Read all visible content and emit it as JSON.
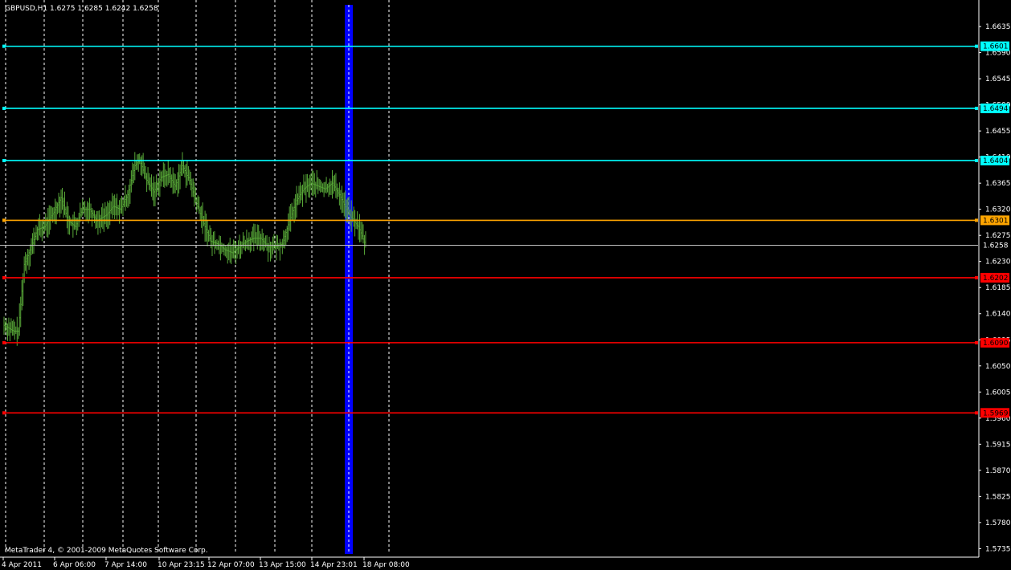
{
  "chart_data": {
    "type": "candlestick",
    "title": "GBPUSD,H1  1.6275 1.6285 1.6242 1.6258",
    "symbol": "GBPUSD",
    "timeframe": "H1",
    "ohlc_header": {
      "open": 1.6275,
      "high": 1.6285,
      "low": 1.6242,
      "close": 1.6258
    },
    "copyright": "MetaTrader 4, © 2001-2009 MetaQuotes Software Corp.",
    "ylim": [
      1.573,
      1.666
    ],
    "y_ticks": [
      1.6635,
      1.659,
      1.6545,
      1.65,
      1.6455,
      1.641,
      1.6365,
      1.632,
      1.6275,
      1.623,
      1.6185,
      1.614,
      1.6095,
      1.605,
      1.6005,
      1.596,
      1.5915,
      1.587,
      1.5825,
      1.578,
      1.5735
    ],
    "x_tick_labels": [
      "4 Apr 2011",
      "6 Apr 06:00",
      "7 Apr 14:00",
      "10 Apr 23:15",
      "12 Apr 07:00",
      "13 Apr 15:00",
      "14 Apr 23:01",
      "18 Apr 08:00"
    ],
    "current_price": 1.6258,
    "horizontal_levels": [
      {
        "value": 1.6601,
        "label": "1.6601",
        "color": "#00ffff"
      },
      {
        "value": 1.6494,
        "label": "1.6494",
        "color": "#00ffff"
      },
      {
        "value": 1.6404,
        "label": "1.6404",
        "color": "#00ffff"
      },
      {
        "value": 1.6301,
        "label": "1.6301",
        "color": "#ffa500"
      },
      {
        "value": 1.6202,
        "label": "1.6202",
        "color": "#ff0000"
      },
      {
        "value": 1.609,
        "label": "1.6090",
        "color": "#ff0000"
      },
      {
        "value": 1.5969,
        "label": "1.5969",
        "color": "#ff0000"
      }
    ],
    "current_price_label": "1.6258",
    "bar_color": "#58a838",
    "vertical_marker_color": "#0000ff",
    "grid": true,
    "price_path": [
      {
        "bar": 0,
        "price": 1.612
      },
      {
        "bar": 8,
        "price": 1.611
      },
      {
        "bar": 12,
        "price": 1.611
      },
      {
        "bar": 17,
        "price": 1.6225
      },
      {
        "bar": 22,
        "price": 1.625
      },
      {
        "bar": 28,
        "price": 1.6285
      },
      {
        "bar": 34,
        "price": 1.629
      },
      {
        "bar": 42,
        "price": 1.6315
      },
      {
        "bar": 48,
        "price": 1.634
      },
      {
        "bar": 54,
        "price": 1.63
      },
      {
        "bar": 60,
        "price": 1.629
      },
      {
        "bar": 66,
        "price": 1.632
      },
      {
        "bar": 72,
        "price": 1.632
      },
      {
        "bar": 78,
        "price": 1.63
      },
      {
        "bar": 86,
        "price": 1.631
      },
      {
        "bar": 92,
        "price": 1.6325
      },
      {
        "bar": 98,
        "price": 1.632
      },
      {
        "bar": 104,
        "price": 1.6345
      },
      {
        "bar": 110,
        "price": 1.6395
      },
      {
        "bar": 114,
        "price": 1.6405
      },
      {
        "bar": 120,
        "price": 1.637
      },
      {
        "bar": 126,
        "price": 1.635
      },
      {
        "bar": 132,
        "price": 1.6375
      },
      {
        "bar": 138,
        "price": 1.638
      },
      {
        "bar": 144,
        "price": 1.636
      },
      {
        "bar": 150,
        "price": 1.6395
      },
      {
        "bar": 156,
        "price": 1.637
      },
      {
        "bar": 162,
        "price": 1.633
      },
      {
        "bar": 168,
        "price": 1.6295
      },
      {
        "bar": 174,
        "price": 1.6265
      },
      {
        "bar": 180,
        "price": 1.626
      },
      {
        "bar": 186,
        "price": 1.625
      },
      {
        "bar": 192,
        "price": 1.6245
      },
      {
        "bar": 198,
        "price": 1.6255
      },
      {
        "bar": 204,
        "price": 1.6265
      },
      {
        "bar": 210,
        "price": 1.627
      },
      {
        "bar": 216,
        "price": 1.627
      },
      {
        "bar": 222,
        "price": 1.6255
      },
      {
        "bar": 228,
        "price": 1.6255
      },
      {
        "bar": 234,
        "price": 1.626
      },
      {
        "bar": 240,
        "price": 1.63
      },
      {
        "bar": 246,
        "price": 1.6335
      },
      {
        "bar": 252,
        "price": 1.6355
      },
      {
        "bar": 258,
        "price": 1.6365
      },
      {
        "bar": 264,
        "price": 1.636
      },
      {
        "bar": 270,
        "price": 1.6355
      },
      {
        "bar": 276,
        "price": 1.6365
      },
      {
        "bar": 282,
        "price": 1.6345
      },
      {
        "bar": 288,
        "price": 1.632
      },
      {
        "bar": 294,
        "price": 1.63
      },
      {
        "bar": 298,
        "price": 1.629
      },
      {
        "bar": 304,
        "price": 1.6258
      }
    ]
  }
}
